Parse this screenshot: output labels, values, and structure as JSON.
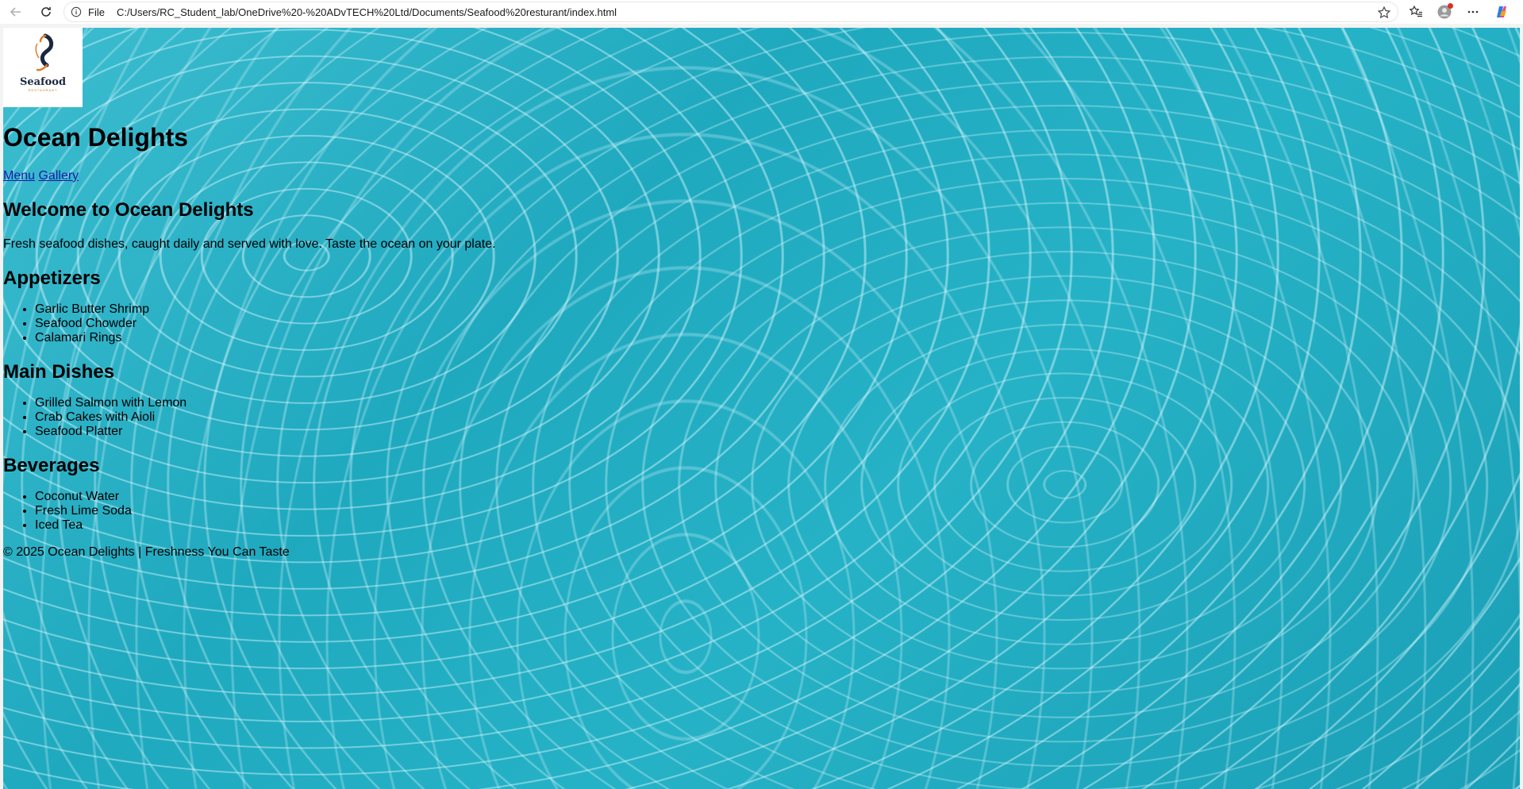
{
  "browser": {
    "file_label": "File",
    "url": "C:/Users/RC_Student_lab/OneDrive%20-%20ADvTECH%20Ltd/Documents/Seafood%20resturant/index.html"
  },
  "logo": {
    "word": "Seafood",
    "sub": "RESTAURANT"
  },
  "site": {
    "title": "Ocean Delights",
    "nav": [
      "Menu",
      "Gallery"
    ],
    "welcome_heading": "Welcome to Ocean Delights",
    "welcome_text": "Fresh seafood dishes, caught daily and served with love. Taste the ocean on your plate.",
    "sections": [
      {
        "heading": "Appetizers",
        "items": [
          "Garlic Butter Shrimp",
          "Seafood Chowder",
          "Calamari Rings"
        ]
      },
      {
        "heading": "Main Dishes",
        "items": [
          "Grilled Salmon with Lemon",
          "Crab Cakes with Aioli",
          "Seafood Platter"
        ]
      },
      {
        "heading": "Beverages",
        "items": [
          "Coconut Water",
          "Fresh Lime Soda",
          "Iced Tea"
        ]
      }
    ],
    "footer": "© 2025 Ocean Delights | Freshness You Can Taste"
  },
  "colors": {
    "water": "#26b2c6",
    "link": "#1a1aa6"
  }
}
